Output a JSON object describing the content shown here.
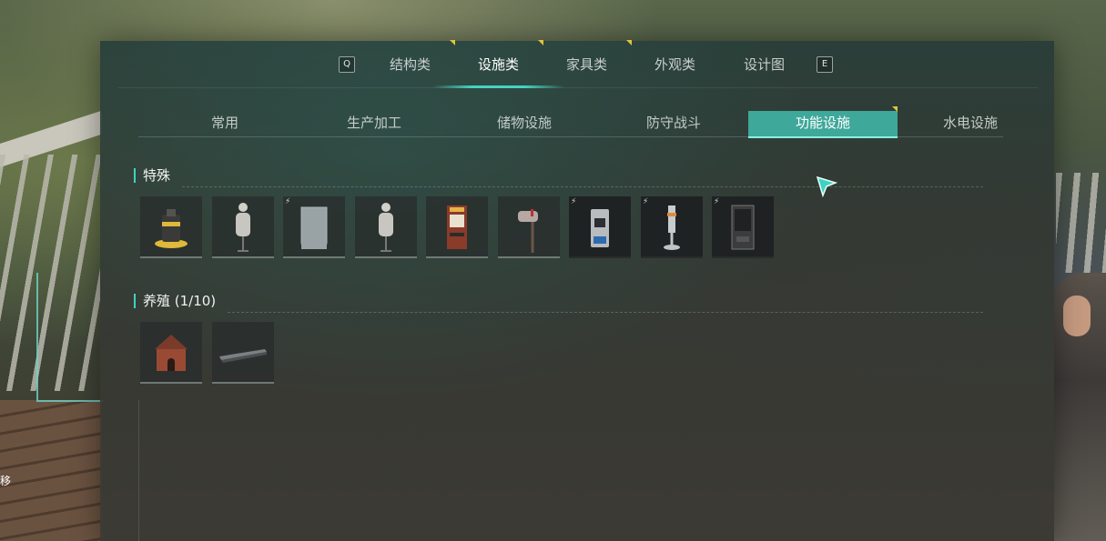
{
  "background": {
    "side_text": "移"
  },
  "nav": {
    "key_left": "Q",
    "key_right": "E",
    "categories": [
      {
        "label": "结构类",
        "active": false,
        "marker": true
      },
      {
        "label": "设施类",
        "active": true,
        "marker": true
      },
      {
        "label": "家具类",
        "active": false,
        "marker": true
      },
      {
        "label": "外观类",
        "active": false,
        "marker": false
      },
      {
        "label": "设计图",
        "active": false,
        "marker": false
      }
    ]
  },
  "subnav": {
    "tabs": [
      {
        "label": "常用",
        "active": false
      },
      {
        "label": "生产加工",
        "active": false
      },
      {
        "label": "储物设施",
        "active": false
      },
      {
        "label": "防守战斗",
        "active": false
      },
      {
        "label": "功能设施",
        "active": true,
        "marker": true
      },
      {
        "label": "水电设施",
        "active": false
      }
    ]
  },
  "sections": [
    {
      "title": "特殊",
      "items": [
        {
          "icon": "generator-machine-icon",
          "powered": false
        },
        {
          "icon": "mannequin-icon",
          "powered": false
        },
        {
          "icon": "glass-cabinet-icon",
          "powered": true
        },
        {
          "icon": "mannequin-icon",
          "powered": false
        },
        {
          "icon": "arcade-machine-icon",
          "powered": false
        },
        {
          "icon": "mailbox-icon",
          "powered": false
        },
        {
          "icon": "water-dispenser-icon",
          "powered": true
        },
        {
          "icon": "heater-lamp-icon",
          "powered": true
        },
        {
          "icon": "vending-machine-icon",
          "powered": true
        }
      ]
    },
    {
      "title": "养殖 (1/10)",
      "items": [
        {
          "icon": "doghouse-icon",
          "powered": false
        },
        {
          "icon": "feeding-trough-icon",
          "powered": false
        }
      ]
    }
  ],
  "colors": {
    "accent": "#3fd3bf",
    "active_tab": "#3ea89a",
    "marker": "#e3c43a"
  }
}
